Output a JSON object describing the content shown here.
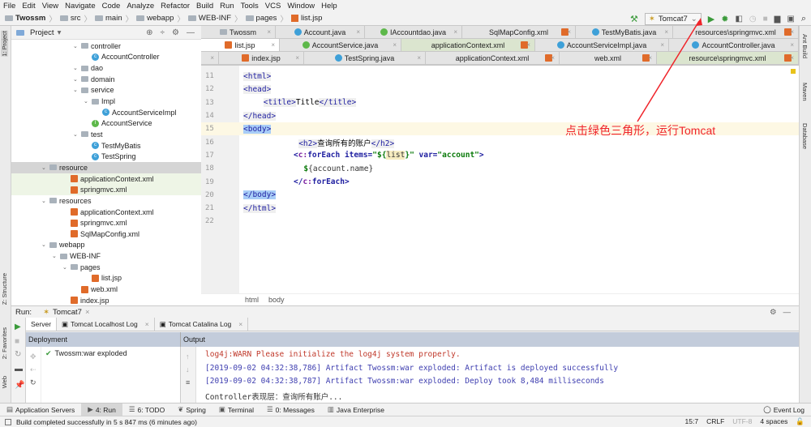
{
  "menu": [
    "File",
    "Edit",
    "View",
    "Navigate",
    "Code",
    "Analyze",
    "Refactor",
    "Build",
    "Run",
    "Tools",
    "VCS",
    "Window",
    "Help"
  ],
  "breadcrumb": [
    "Twossm",
    "src",
    "main",
    "webapp",
    "WEB-INF",
    "pages",
    "list.jsp"
  ],
  "toolbar": {
    "run_config": "Tomcat7"
  },
  "left_strip": {
    "project": "1: Project",
    "structure": "Z: Structure",
    "favorites": "2: Favorites",
    "web": "Web"
  },
  "right_strip": {
    "ant": "Ant Build",
    "maven": "Maven",
    "database": "Database"
  },
  "project": {
    "title": "Project",
    "tree": [
      {
        "label": "controller",
        "type": "folder",
        "depth": 6,
        "open": true
      },
      {
        "label": "AccountController",
        "type": "class",
        "depth": 7
      },
      {
        "label": "dao",
        "type": "folder",
        "depth": 6,
        "open": false
      },
      {
        "label": "domain",
        "type": "folder",
        "depth": 6,
        "open": false
      },
      {
        "label": "service",
        "type": "folder",
        "depth": 6,
        "open": true
      },
      {
        "label": "Impl",
        "type": "folder",
        "depth": 7,
        "open": true
      },
      {
        "label": "AccountServiceImpl",
        "type": "class",
        "depth": 8
      },
      {
        "label": "AccountService",
        "type": "interface",
        "depth": 7
      },
      {
        "label": "test",
        "type": "folder",
        "depth": 6,
        "open": true
      },
      {
        "label": "TestMyBatis",
        "type": "class",
        "depth": 7
      },
      {
        "label": "TestSpring",
        "type": "class",
        "depth": 7
      },
      {
        "label": "resource",
        "type": "folder",
        "depth": 3,
        "open": true,
        "state": "selected"
      },
      {
        "label": "applicationContext.xml",
        "type": "xml",
        "depth": 5,
        "state": "green"
      },
      {
        "label": "springmvc.xml",
        "type": "xml",
        "depth": 5,
        "state": "green"
      },
      {
        "label": "resources",
        "type": "folder",
        "depth": 3,
        "open": true
      },
      {
        "label": "applicationContext.xml",
        "type": "xml",
        "depth": 5
      },
      {
        "label": "springmvc.xml",
        "type": "xml",
        "depth": 5
      },
      {
        "label": "SqlMapConfig.xml",
        "type": "xml",
        "depth": 5
      },
      {
        "label": "webapp",
        "type": "folder",
        "depth": 3,
        "open": true
      },
      {
        "label": "WEB-INF",
        "type": "folder",
        "depth": 4,
        "open": true
      },
      {
        "label": "pages",
        "type": "folder",
        "depth": 5,
        "open": true
      },
      {
        "label": "list.jsp",
        "type": "jsp",
        "depth": 7
      },
      {
        "label": "web.xml",
        "type": "xml",
        "depth": 6
      },
      {
        "label": "index.jsp",
        "type": "jsp",
        "depth": 5
      }
    ]
  },
  "tabs": [
    [
      {
        "label": "Twossm",
        "w": 92
      },
      {
        "label": "Account.java",
        "w": 110
      },
      {
        "label": "IAccountdao.java",
        "w": 120
      },
      {
        "label": "SqlMapConfig.xml",
        "w": 140
      },
      {
        "label": "TestMyBatis.java",
        "w": 120
      },
      {
        "label": "resources\\springmvc.xml",
        "w": 155
      }
    ],
    [
      {
        "label": "list.jsp",
        "w": 97,
        "state": "active"
      },
      {
        "label": "AccountService.java",
        "w": 150
      },
      {
        "label": "applicationContext.xml",
        "w": 165,
        "state": "green"
      },
      {
        "label": "AccountServiceImpl.java",
        "w": 165
      },
      {
        "label": "AccountController.java",
        "w": 160
      }
    ],
    [
      {
        "label": "",
        "w": 22
      },
      {
        "label": "index.jsp",
        "w": 105
      },
      {
        "label": "TestSpring.java",
        "w": 150
      },
      {
        "label": "applicationContext.xml",
        "w": 165
      },
      {
        "label": "web.xml",
        "w": 120
      },
      {
        "label": "resource\\springmvc.xml",
        "w": 175,
        "state": "green"
      }
    ]
  ],
  "editor": {
    "lines": [
      {
        "n": "11",
        "indent": 0,
        "segs": [
          [
            "t hl0",
            "<html>"
          ]
        ]
      },
      {
        "n": "12",
        "indent": 0,
        "segs": [
          [
            "t",
            "<head>"
          ]
        ]
      },
      {
        "n": "13",
        "indent": 4,
        "segs": [
          [
            "t",
            "<title>"
          ],
          [
            "p",
            "Title"
          ],
          [
            "t",
            "</title>"
          ]
        ]
      },
      {
        "n": "14",
        "indent": 0,
        "segs": [
          [
            "t",
            "</head>"
          ]
        ]
      },
      {
        "n": "15",
        "indent": 0,
        "segs": [
          [
            "t hl",
            "<body>"
          ]
        ],
        "current": true
      },
      {
        "n": "16",
        "indent": 11,
        "segs": [
          [
            "t",
            "<h2>"
          ],
          [
            "p",
            "查询所有的账户"
          ],
          [
            "t",
            "</h2>"
          ]
        ]
      },
      {
        "n": "17",
        "indent": 10,
        "segs": [
          [
            "el",
            "<"
          ],
          [
            "ns",
            "c:"
          ],
          [
            "el",
            "forEach "
          ],
          [
            "a",
            "items="
          ],
          [
            "s",
            "\"${"
          ],
          [
            "v hl",
            "list"
          ],
          [
            "s",
            "}\""
          ],
          [
            "a",
            " var="
          ],
          [
            "s",
            "\"account\""
          ],
          [
            "el",
            ">"
          ]
        ]
      },
      {
        "n": "18",
        "indent": 12,
        "segs": [
          [
            "s",
            "$"
          ],
          [
            "v",
            "{account.name}"
          ]
        ]
      },
      {
        "n": "19",
        "indent": 10,
        "segs": [
          [
            "el",
            "</"
          ],
          [
            "ns",
            "c:"
          ],
          [
            "el",
            "forEach>"
          ]
        ]
      },
      {
        "n": "20",
        "indent": 0,
        "segs": [
          [
            "t hl",
            "</body>"
          ]
        ]
      },
      {
        "n": "21",
        "indent": 0,
        "segs": [
          [
            "t",
            "</html>"
          ]
        ]
      },
      {
        "n": "22",
        "indent": 0,
        "segs": []
      }
    ],
    "breadcrumb": [
      "html",
      "body"
    ]
  },
  "annotation": "点击绿色三角形，运行Tomcat",
  "run": {
    "label": "Run:",
    "config": "Tomcat7",
    "tabs": [
      "Server",
      "Tomcat Localhost Log",
      "Tomcat Catalina Log"
    ],
    "deployment_header": "Deployment",
    "output_header": "Output",
    "deployment": "Twossm:war exploded",
    "output": [
      {
        "text": "log4j:WARN Please initialize the log4j system properly.",
        "color": "#c0392b"
      },
      {
        "text": "[2019-09-02 04:32:38,786] Artifact Twossm:war exploded: Artifact is deployed successfully",
        "color": "#3f3fb0"
      },
      {
        "text": "[2019-09-02 04:32:38,787] Artifact Twossm:war exploded: Deploy took 8,484 milliseconds",
        "color": "#3f3fb0"
      },
      {
        "text": "Controller表现层：查询所有账户...",
        "color": "#333"
      }
    ]
  },
  "bottom_tabs": [
    "Application Servers",
    "4: Run",
    "6: TODO",
    "Spring",
    "Terminal",
    "0: Messages",
    "Java Enterprise"
  ],
  "event_log": "Event Log",
  "status": {
    "message": "Build completed successfully in 5 s 847 ms (6 minutes ago)",
    "position": "15:7",
    "line_sep": "CRLF",
    "encoding": "UTF-8",
    "indent": "4 spaces"
  }
}
